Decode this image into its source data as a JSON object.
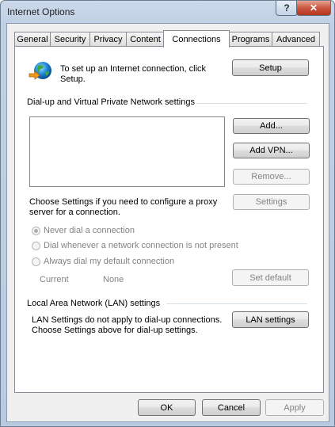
{
  "window": {
    "title": "Internet Options",
    "help_glyph": "?",
    "close_glyph": "✕"
  },
  "tabs": [
    {
      "label": "General"
    },
    {
      "label": "Security"
    },
    {
      "label": "Privacy"
    },
    {
      "label": "Content"
    },
    {
      "label": "Connections",
      "active": true
    },
    {
      "label": "Programs"
    },
    {
      "label": "Advanced"
    }
  ],
  "setup": {
    "icon": "globe-network-icon",
    "text_line1": "To set up an Internet connection, click",
    "text_line2": "Setup.",
    "button": "Setup"
  },
  "dialup": {
    "group_label": "Dial-up and Virtual Private Network settings",
    "add_button": "Add...",
    "add_vpn_button": "Add VPN...",
    "remove_button": "Remove...",
    "settings_text_line1": "Choose Settings if you need to configure a proxy",
    "settings_text_line2": "server for a connection.",
    "settings_button": "Settings",
    "radios": [
      {
        "label": "Never dial a connection",
        "selected": true
      },
      {
        "label": "Dial whenever a network connection is not present",
        "selected": false
      },
      {
        "label": "Always dial my default connection",
        "selected": false
      }
    ],
    "current_label": "Current",
    "current_value": "None",
    "set_default_button": "Set default"
  },
  "lan": {
    "group_label": "Local Area Network (LAN) settings",
    "text_line1": "LAN Settings do not apply to dial-up connections.",
    "text_line2": "Choose Settings above for dial-up settings.",
    "button": "LAN settings"
  },
  "footer": {
    "ok": "OK",
    "cancel": "Cancel",
    "apply": "Apply"
  }
}
